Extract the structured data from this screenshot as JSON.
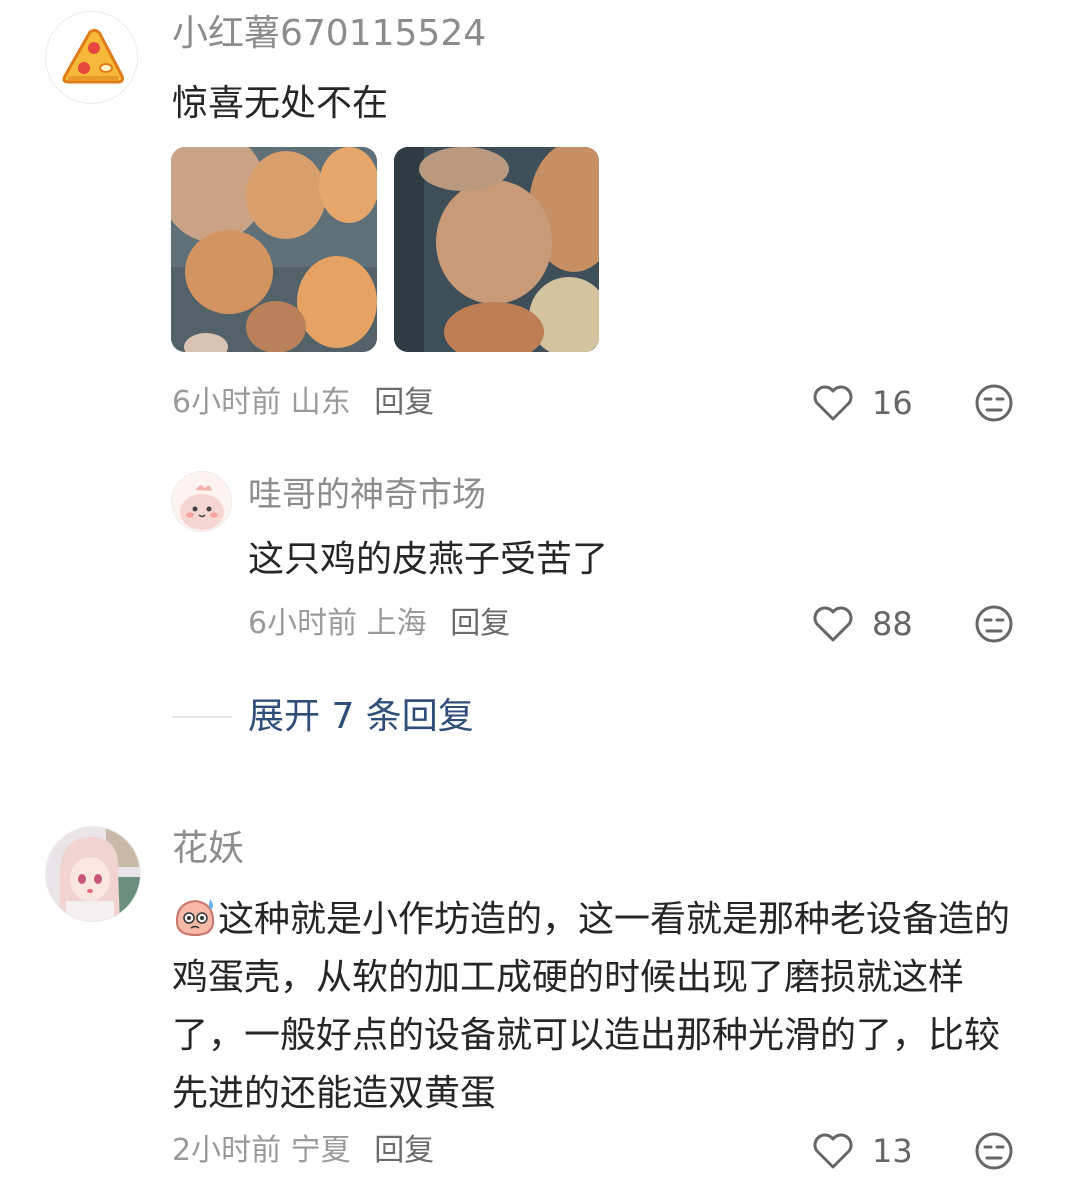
{
  "comments": [
    {
      "username": "小红薯670115524",
      "text": "惊喜无处不在",
      "time": "6小时前",
      "location": "山东",
      "reply_label": "回复",
      "likes": "16",
      "avatar_icon": "pizza-slice-icon",
      "images": [
        "egg-photo-1",
        "egg-photo-2"
      ],
      "replies": [
        {
          "username": "哇哥的神奇市场",
          "text": "这只鸡的皮燕子受苦了",
          "time": "6小时前",
          "location": "上海",
          "reply_label": "回复",
          "likes": "88",
          "avatar_icon": "pink-blob-avatar"
        }
      ],
      "expand_label": "展开 7 条回复"
    },
    {
      "username": "花妖",
      "text": "这种就是小作坊造的，这一看就是那种老设备造的鸡蛋壳，从软的加工成硬的时候出现了磨损就这样了，一般好点的设备就可以造出那种光滑的了，比较先进的还能造双黄蛋",
      "emoji": "sweat-face-emoji",
      "time": "2小时前",
      "location": "宁夏",
      "reply_label": "回复",
      "likes": "13",
      "avatar_icon": "anime-girl-avatar"
    }
  ],
  "colors": {
    "username": "#8c8c8c",
    "text": "#262626",
    "meta": "#9a9a9a",
    "expand": "#2f4e79"
  }
}
